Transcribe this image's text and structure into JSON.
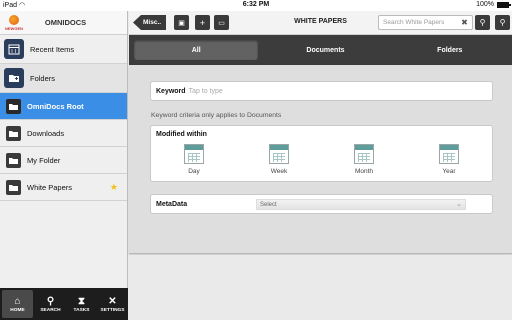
{
  "status_bar": {
    "device": "iPad",
    "time": "6:32 PM",
    "battery": "100%"
  },
  "sidebar": {
    "logo_text": "NEWGEN",
    "title": "OMNIDOCS",
    "items": [
      {
        "label": "Recent Items"
      },
      {
        "label": "Folders"
      },
      {
        "label": "OmniDocs Root"
      },
      {
        "label": "Downloads"
      },
      {
        "label": "My Folder"
      },
      {
        "label": "White Papers"
      }
    ],
    "tabs": [
      {
        "label": "HOME"
      },
      {
        "label": "SEARCH"
      },
      {
        "label": "TASKS"
      },
      {
        "label": "SETTINGS"
      }
    ]
  },
  "toolbar": {
    "back_label": "Misc..",
    "title": "WHITE PAPERS",
    "search_placeholder": "Search White Papers"
  },
  "segments": [
    "All",
    "Documents",
    "Folders"
  ],
  "search_form": {
    "keyword_label": "Keyword",
    "keyword_placeholder": "Tap to type",
    "note": "Keyword criteria only applies to Documents",
    "modified_label": "Modified within",
    "periods": [
      "Day",
      "Week",
      "Month",
      "Year"
    ],
    "metadata_label": "MetaData",
    "metadata_select": "Select"
  },
  "colors": {
    "selected": "#3a8ee6",
    "dark": "#3a3a3a",
    "accent_star": "#f3c21a"
  }
}
